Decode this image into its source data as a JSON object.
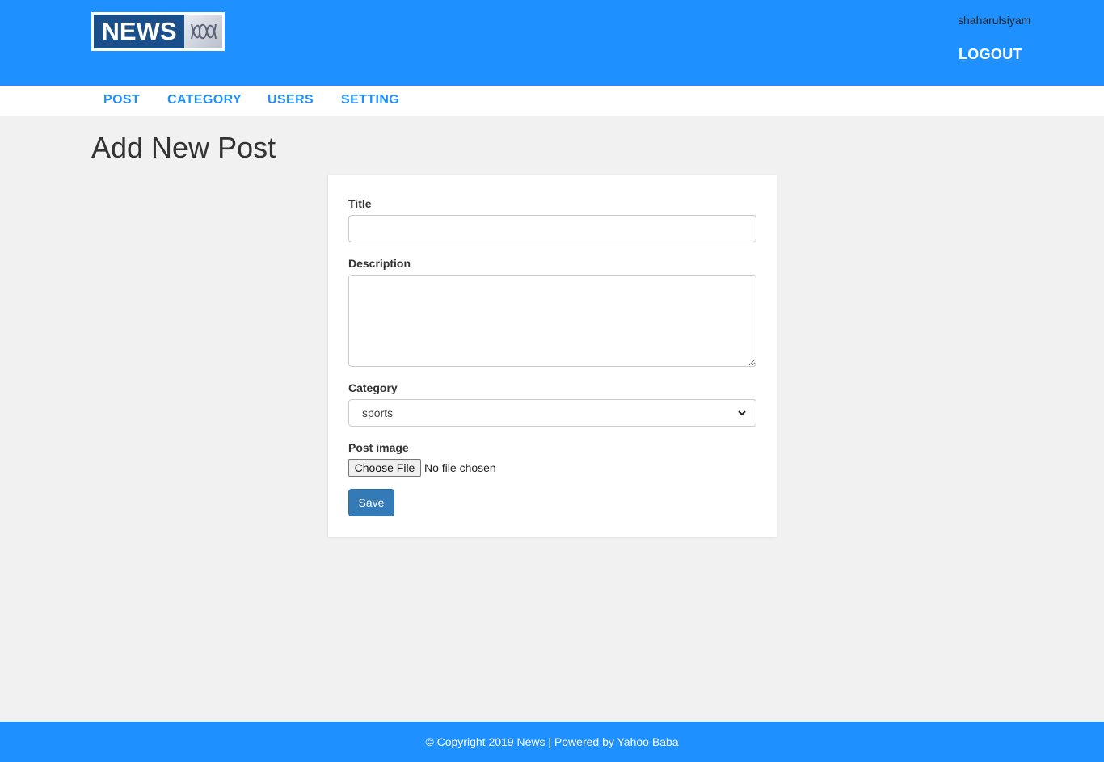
{
  "header": {
    "logo_text": "NEWS",
    "username": "shaharulsiyam",
    "logout_label": "LOGOUT"
  },
  "nav": {
    "items": [
      {
        "label": "POST"
      },
      {
        "label": "CATEGORY"
      },
      {
        "label": "USERS"
      },
      {
        "label": "SETTING"
      }
    ]
  },
  "page": {
    "title": "Add New Post"
  },
  "form": {
    "title_label": "Title",
    "title_value": "",
    "description_label": "Description",
    "description_value": "",
    "category_label": "Category",
    "category_selected": "sports",
    "image_label": "Post image",
    "file_button_label": "Choose File",
    "file_status": "No file chosen",
    "save_label": "Save"
  },
  "footer": {
    "text": "© Copyright 2019 News | Powered by Yahoo Baba"
  },
  "colors": {
    "header": "#1e90ff",
    "nav_link": "#1e90ff",
    "save_button": "#337ab7",
    "background": "#f1f1f1"
  },
  "icons": {
    "logo_mark": "abc-lines-logo-icon",
    "select_arrow": "chevron-down-icon"
  }
}
